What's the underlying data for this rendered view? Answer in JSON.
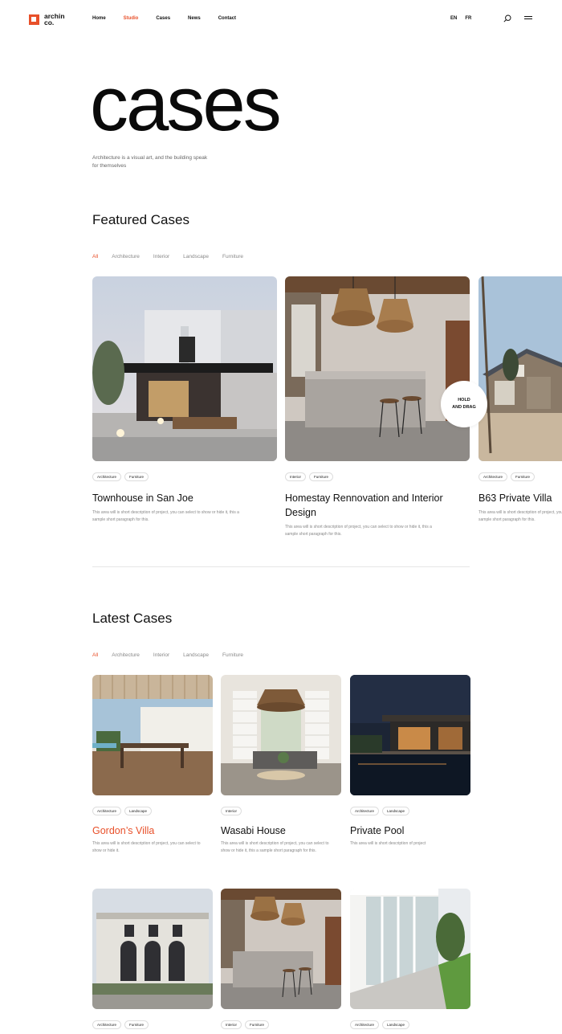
{
  "header": {
    "logo_line1": "archin",
    "logo_line2": "co.",
    "nav": [
      "Home",
      "Studio",
      "Cases",
      "News",
      "Contact"
    ],
    "active_nav": "Studio",
    "lang": [
      "EN",
      "FR"
    ]
  },
  "hero": {
    "title": "cases",
    "subtitle": "Architecture is a visual art, and the building speak for themselves"
  },
  "featured": {
    "title": "Featured Cases",
    "filters": [
      "All",
      "Architecture",
      "Interior",
      "Landscape",
      "Furniture"
    ],
    "drag_badge_line1": "HOLD",
    "drag_badge_line2": "AND DRAG",
    "cards": [
      {
        "title": "Townhouse in San Joe",
        "tags": [
          "Architecture",
          "Furniture"
        ],
        "desc": "This area will is short description of project, you can select to show or hide it, this a sample short paragraph for this."
      },
      {
        "title": "Homestay Rennovation and Interior Design",
        "tags": [
          "Interior",
          "Furniture"
        ],
        "desc": "This area will is short description of project, you can select to show or hide it, this a sample short paragraph for this."
      },
      {
        "title": "B63 Private Villa",
        "tags": [
          "Architecture",
          "Furniture"
        ],
        "desc": "This area will is short description of project, you can select to show or hide it, this a sample short paragraph for this."
      }
    ]
  },
  "latest": {
    "title": "Latest Cases",
    "filters": [
      "All",
      "Architecture",
      "Interior",
      "Landscape",
      "Furniture"
    ],
    "cards": [
      {
        "title": "Gordon’s Villa",
        "tags": [
          "Architecture",
          "Landscape"
        ],
        "desc": "This area will is short description of project, you can select to show or hide it."
      },
      {
        "title": "Wasabi House",
        "tags": [
          "Interior"
        ],
        "desc": "This area will is short description of project, you can select to show or hide it, this a sample short paragraph for this."
      },
      {
        "title": "Private Pool",
        "tags": [
          "Architecture",
          "Landscape"
        ],
        "desc": "This area will is short description of project"
      },
      {
        "title": "",
        "tags": [
          "Architecture",
          "Furniture"
        ],
        "desc": ""
      },
      {
        "title": "",
        "tags": [
          "Interior",
          "Furniture"
        ],
        "desc": ""
      },
      {
        "title": "",
        "tags": [
          "Architecture",
          "Landscape"
        ],
        "desc": ""
      }
    ]
  },
  "colors": {
    "accent": "#e8502a"
  }
}
